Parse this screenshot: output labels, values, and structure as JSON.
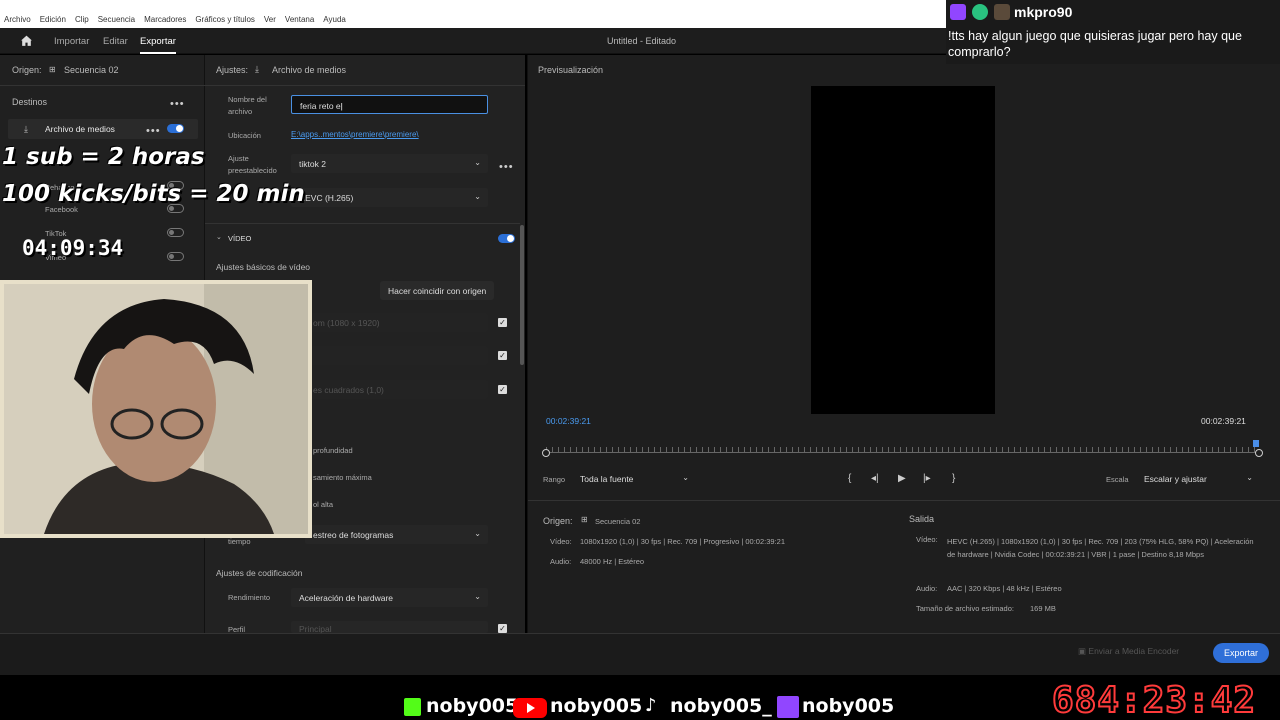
{
  "menubar": {
    "items": [
      "Archivo",
      "Edición",
      "Clip",
      "Secuencia",
      "Marcadores",
      "Gráficos y títulos",
      "Ver",
      "Ventana",
      "Ayuda"
    ]
  },
  "header": {
    "tabs": [
      "Importar",
      "Editar",
      "Exportar"
    ],
    "title": "Untitled - Editado"
  },
  "left": {
    "origin_label": "Origen:",
    "origin_value": "Secuencia 02",
    "destinations_label": "Destinos",
    "dest_media": "Archivo de medios",
    "dest_facebook": "Facebook",
    "dest_tiktok": "TikTok",
    "dest_vimeo": "Vimeo",
    "dest_behance": "Behance"
  },
  "settings": {
    "header_label": "Ajustes:",
    "header_value": "Archivo de medios",
    "filename_label_1": "Nombre del",
    "filename_label_2": "archivo",
    "filename_value": "feria reto e",
    "location_label": "Ubicación",
    "location_value": "E:\\apps..mentos\\premiere\\premiere\\",
    "preset_label_1": "Ajuste",
    "preset_label_2": "preestablecido",
    "preset_value": "tiktok 2",
    "format_value": "HEVC (H.265)",
    "video_section": "VÍDEO",
    "basic_video": "Ajustes básicos de vídeo",
    "match_source": "Hacer coincidir con origen",
    "frame_size": "om (1080 x 1920)",
    "pixel_aspect": "es cuadrados (1,0)",
    "depth": "profundidad",
    "render_max": "samiento máxima",
    "quality": "ol alta",
    "time_label": "tiempo",
    "frame_sampling": "estreo de fotogramas",
    "encoding_settings": "Ajustes de codificación",
    "performance_label": "Rendimiento",
    "performance_value": "Aceleración de hardware",
    "profile_label": "Perfil",
    "profile_value": "Principal"
  },
  "preview": {
    "label": "Previsualización",
    "time_in": "00:02:39:21",
    "time_out": "00:02:39:21",
    "range_label": "Rango",
    "range_value": "Toda la fuente",
    "scale_label": "Escala",
    "scale_value": "Escalar y ajustar"
  },
  "summary": {
    "origin_label": "Origen:",
    "origin_value": "Secuencia 02",
    "video_label": "Vídeo:",
    "video_value": "1080x1920 (1,0)  |  30 fps  |  Rec. 709  |  Progresivo  |  00:02:39:21",
    "audio_label": "Audio:",
    "audio_value": "48000 Hz  |  Estéreo",
    "output_label": "Salida",
    "out_video_label": "Vídeo:",
    "out_video_value": "HEVC (H.265)  |  1080x1920 (1,0)  |  30 fps  |  Rec. 709  |  203 (75% HLG, 58% PQ)  |  Aceleración de hardware  |  Nvidia Codec  |  00:02:39:21  |  VBR  |  1 pase  |  Destino 8,18 Mbps",
    "out_audio_label": "Audio:",
    "out_audio_value": "AAC  |  320 Kbps  |  48 kHz  |  Estéreo",
    "size_label": "Tamaño de archivo estimado:",
    "size_value": "169 MB"
  },
  "footer": {
    "media_encoder": "Enviar a Media Encoder",
    "export": "Exportar"
  },
  "overlay": {
    "chat_user": "mkpro90",
    "chat_message": "!tts hay algun juego que quisieras jugar pero hay que comprarlo?",
    "goal_1": "1 sub = 2 horas",
    "goal_2": "100 kicks/bits = 20 min",
    "small_timer": "04:09:34",
    "big_timer": "684:23:42",
    "social_kick": "noby005",
    "social_youtube": "noby005",
    "social_tiktok": "noby005_",
    "social_twitch": "noby005"
  },
  "colors": {
    "accent": "#2f6fd8",
    "link": "#4a9bf0",
    "kick": "#53fc18",
    "youtube": "#ff0000",
    "twitch": "#9146ff",
    "timer_stroke": "#ff3b3b"
  }
}
